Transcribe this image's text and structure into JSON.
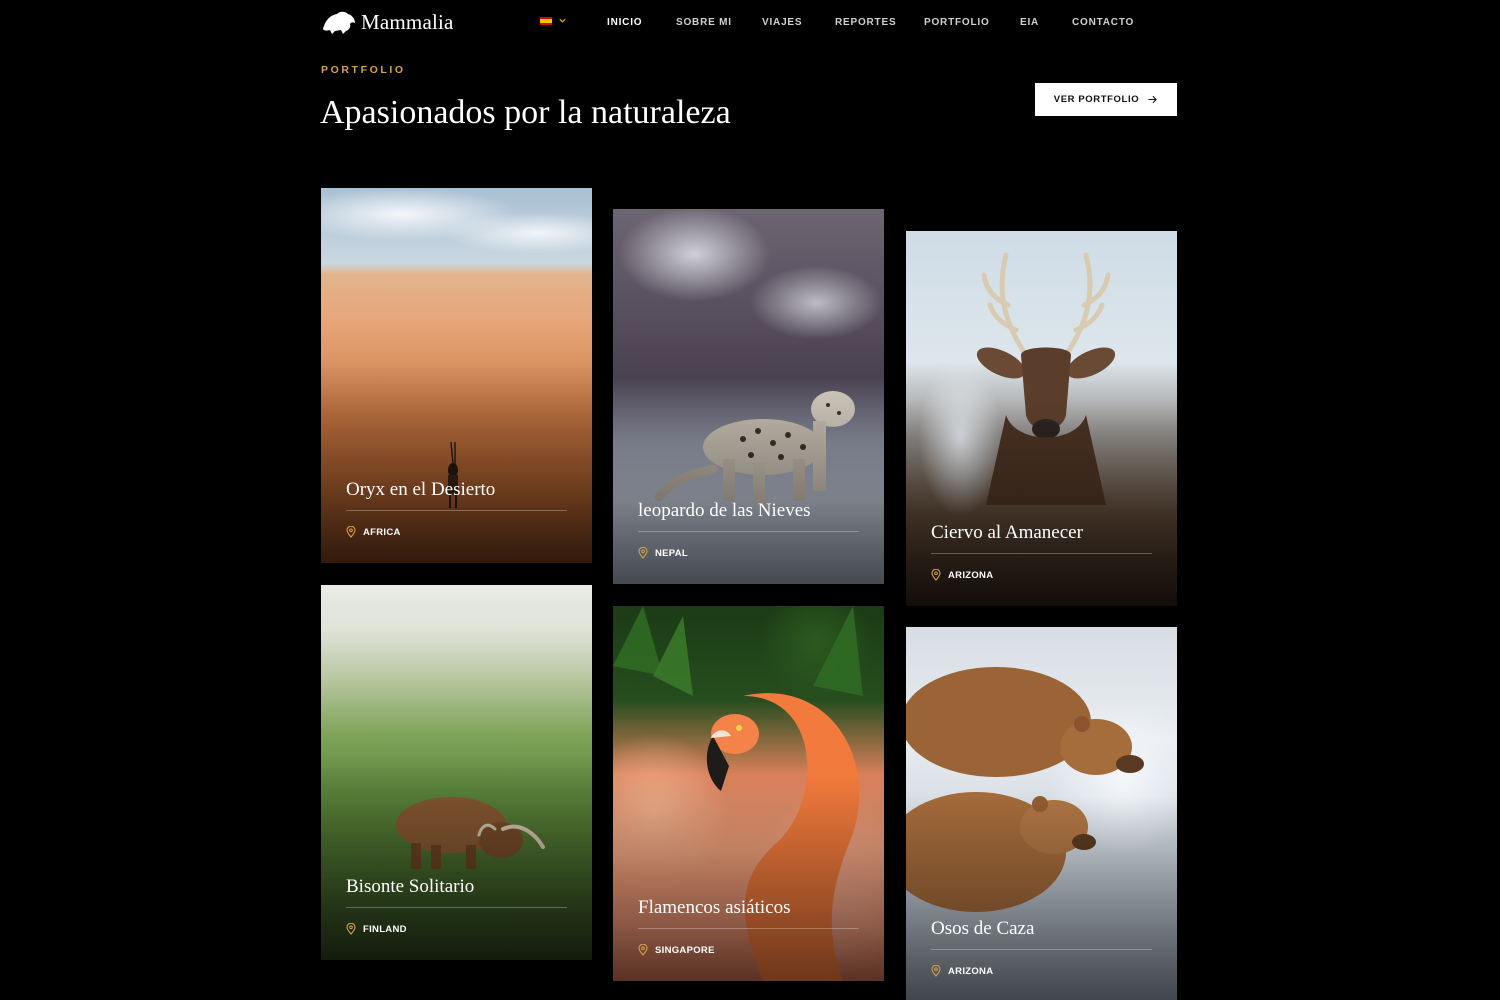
{
  "brand": {
    "name": "Mammalia"
  },
  "header": {
    "language": {
      "flag": "es",
      "icon": "chevron-down-icon"
    },
    "nav": [
      {
        "label": "INICIO",
        "active": true
      },
      {
        "label": "SOBRE MI"
      },
      {
        "label": "VIAJES"
      },
      {
        "label": "REPORTES"
      },
      {
        "label": "PORTFOLIO"
      },
      {
        "label": "EIA"
      },
      {
        "label": "CONTACTO"
      }
    ]
  },
  "section": {
    "eyebrow": "PORTFOLIO",
    "title": "Apasionados por la naturaleza",
    "cta_label": "VER PORTFOLIO",
    "cta_icon": "arrow-right-icon"
  },
  "cards": [
    {
      "title": "Oryx en el Desierto",
      "location": "AFRICA"
    },
    {
      "title": "leopardo de las Nieves",
      "location": "NEPAL"
    },
    {
      "title": "Ciervo al Amanecer",
      "location": "ARIZONA"
    },
    {
      "title": "Bisonte Solitario",
      "location": "FINLAND"
    },
    {
      "title": "Flamencos asiáticos",
      "location": "SINGAPORE"
    },
    {
      "title": "Osos de Caza",
      "location": "ARIZONA"
    }
  ],
  "colors": {
    "accent": "#d6a24a",
    "background": "#000000",
    "button_bg": "#ffffff"
  }
}
